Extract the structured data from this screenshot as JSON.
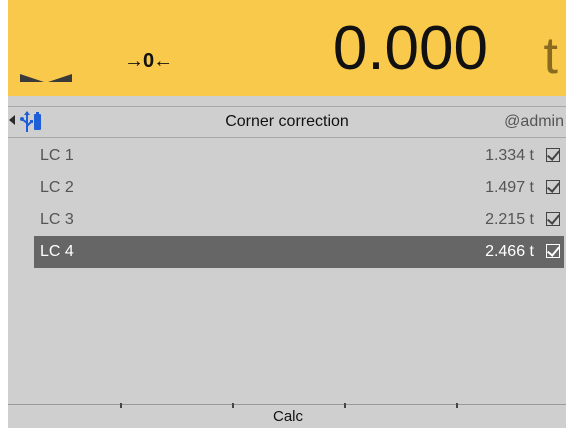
{
  "display": {
    "zero_indicator": "→0←",
    "weight": "0.000",
    "unit": "t",
    "motion_icon": "motion-triangles-icon"
  },
  "titlebar": {
    "back_icon": "left-arrow-icon",
    "usb_icon": "usb-icon",
    "title": "Corner correction",
    "user": "@admin"
  },
  "loadcells": [
    {
      "label": "LC 1",
      "value": "1.334 t",
      "checked": true,
      "selected": false
    },
    {
      "label": "LC 2",
      "value": "1.497 t",
      "checked": true,
      "selected": false
    },
    {
      "label": "LC 3",
      "value": "2.215 t",
      "checked": true,
      "selected": false
    },
    {
      "label": "LC 4",
      "value": "2.466 t",
      "checked": true,
      "selected": true
    }
  ],
  "softkeys": [
    "",
    "",
    "Calc",
    "",
    ""
  ],
  "colors": {
    "display_bg": "#f8c94a",
    "selected_row": "#666666",
    "usb_blue": "#1e5fd8"
  }
}
